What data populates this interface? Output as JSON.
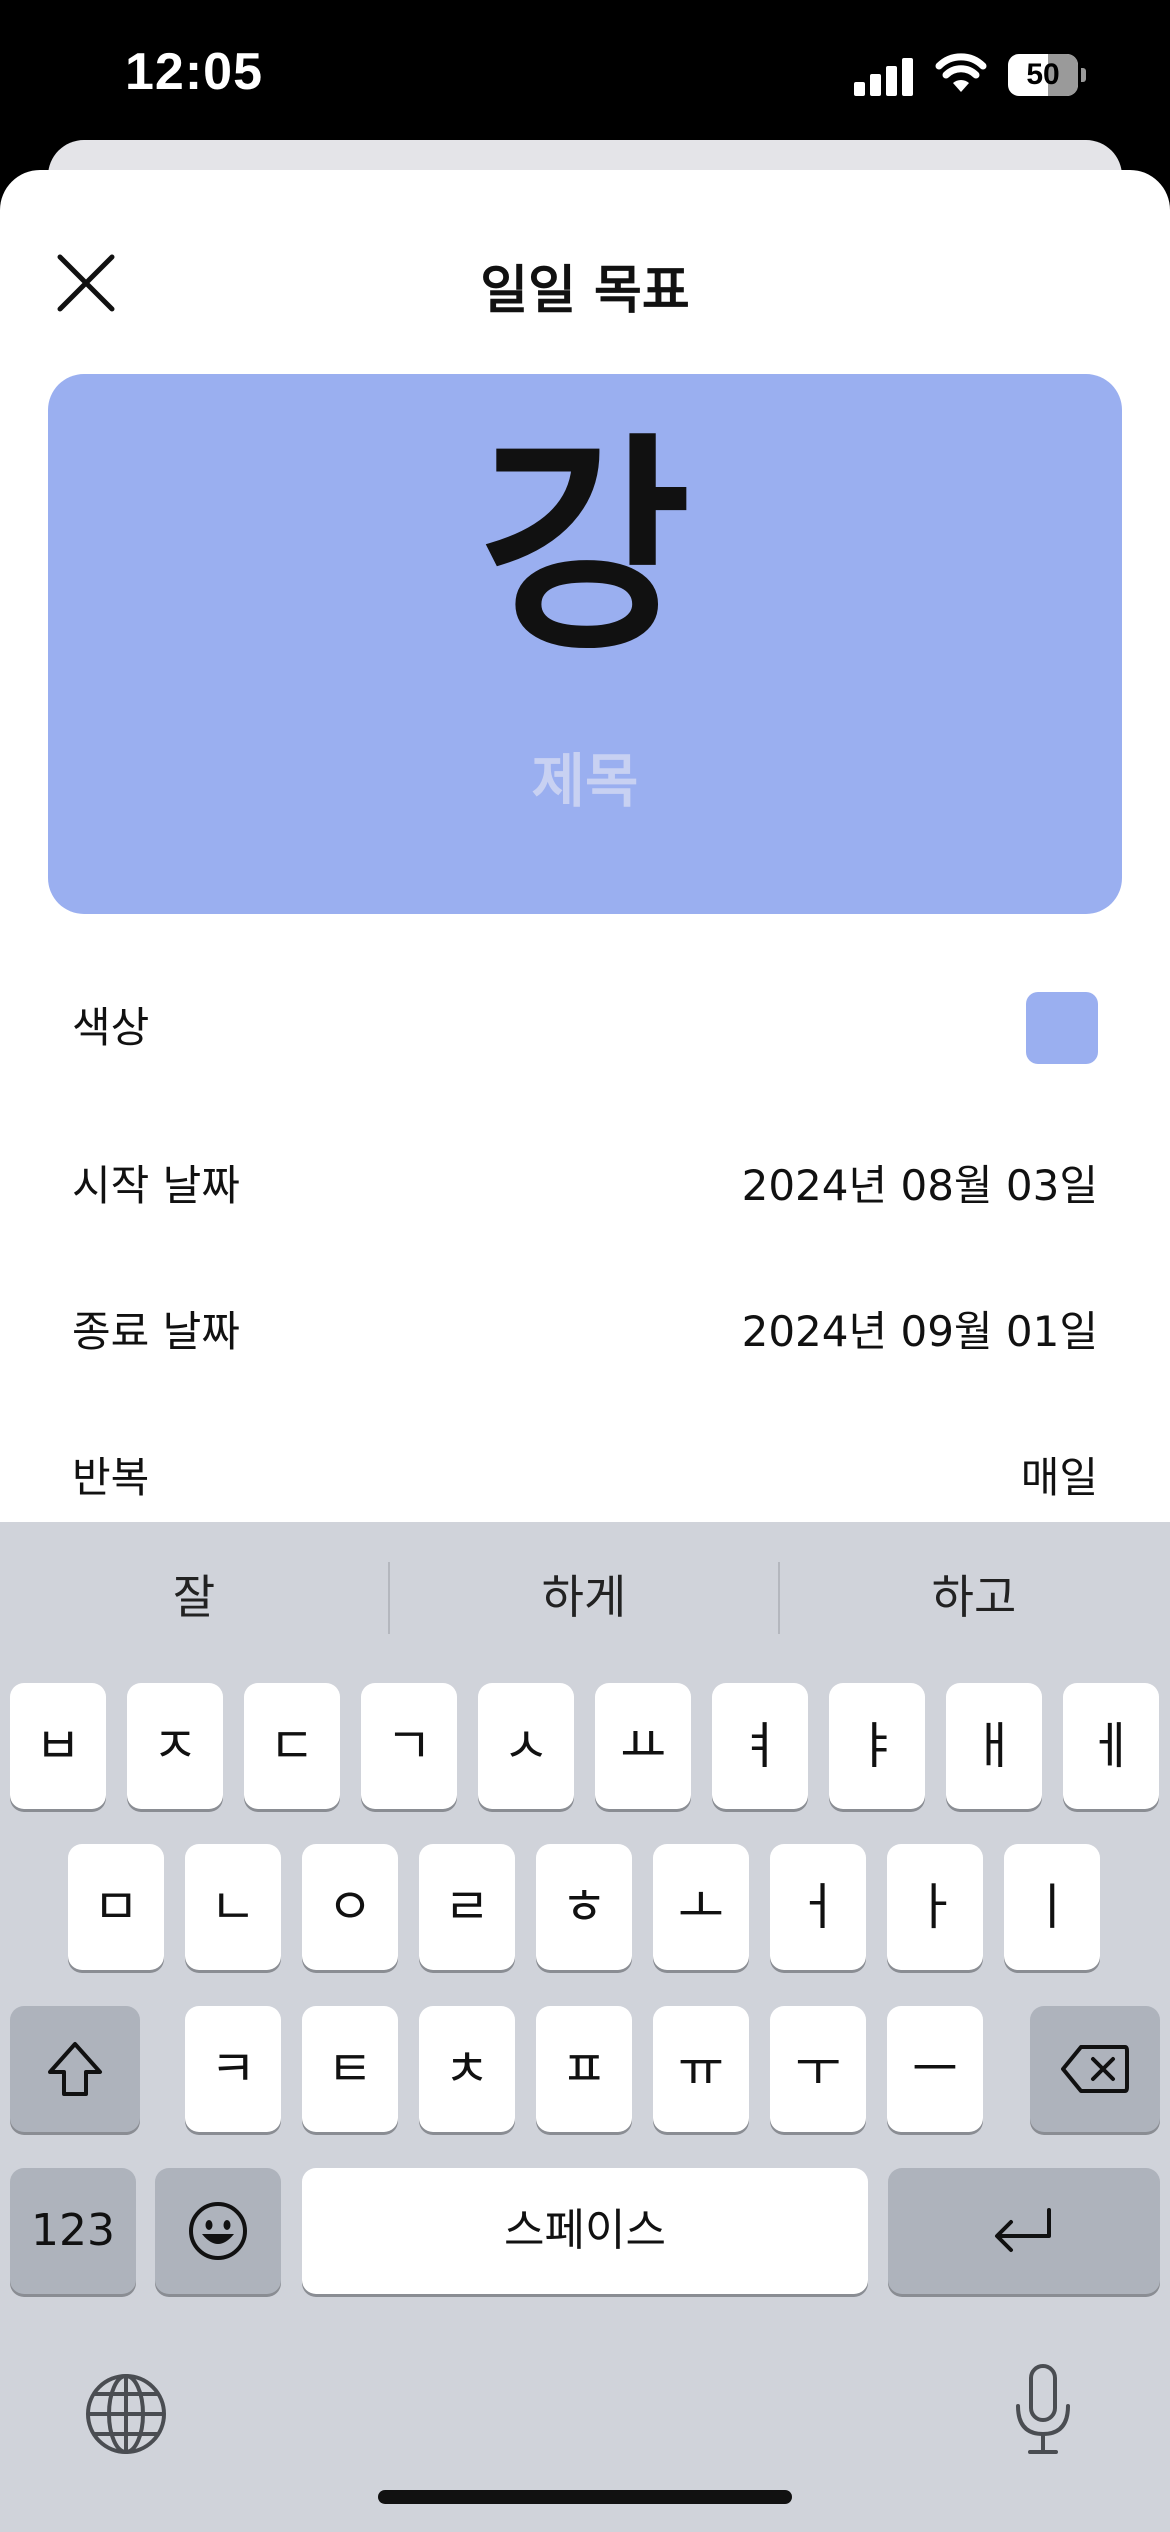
{
  "status_bar": {
    "time": "12:05",
    "battery_level": "50"
  },
  "sheet": {
    "title": "일일 목표",
    "preview": {
      "character": "강",
      "title_placeholder": "제목"
    },
    "color_label": "색상",
    "accent_color": "#9aaff0",
    "start_date": {
      "label": "시작 날짜",
      "value": "2024년 08월 03일"
    },
    "end_date": {
      "label": "종료 날짜",
      "value": "2024년 09월 01일"
    },
    "repeat": {
      "label": "반복",
      "value": "매일"
    }
  },
  "keyboard": {
    "suggestions": [
      "잘",
      "하게",
      "하고"
    ],
    "row1": [
      "ㅂ",
      "ㅈ",
      "ㄷ",
      "ㄱ",
      "ㅅ",
      "ㅛ",
      "ㅕ",
      "ㅑ",
      "ㅐ",
      "ㅔ"
    ],
    "row2": [
      "ㅁ",
      "ㄴ",
      "ㅇ",
      "ㄹ",
      "ㅎ",
      "ㅗ",
      "ㅓ",
      "ㅏ",
      "ㅣ"
    ],
    "row3": [
      "ㅋ",
      "ㅌ",
      "ㅊ",
      "ㅍ",
      "ㅠ",
      "ㅜ",
      "ㅡ"
    ],
    "numbers_label": "123",
    "space_label": "스페이스"
  }
}
